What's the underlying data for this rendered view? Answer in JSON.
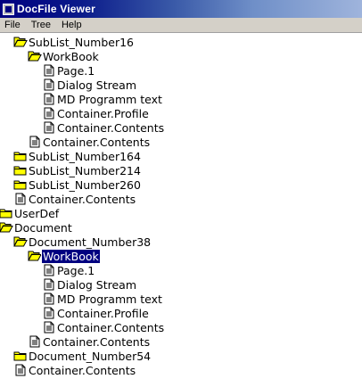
{
  "window": {
    "title": "DocFile Viewer"
  },
  "menu": {
    "file": "File",
    "tree": "Tree",
    "help": "Help"
  },
  "tree": {
    "nodes": [
      {
        "label": "SubList_Number16",
        "icon": "folder-open-icon",
        "depth": 2
      },
      {
        "label": "WorkBook",
        "icon": "folder-open-icon",
        "depth": 3
      },
      {
        "label": "Page.1",
        "icon": "document-icon",
        "depth": 4
      },
      {
        "label": "Dialog Stream",
        "icon": "document-icon",
        "depth": 4
      },
      {
        "label": "MD Programm text",
        "icon": "document-icon",
        "depth": 4
      },
      {
        "label": "Container.Profile",
        "icon": "document-icon",
        "depth": 4
      },
      {
        "label": "Container.Contents",
        "icon": "document-icon",
        "depth": 4
      },
      {
        "label": "Container.Contents",
        "icon": "document-icon",
        "depth": 3
      },
      {
        "label": "SubList_Number164",
        "icon": "folder-closed-icon",
        "depth": 2
      },
      {
        "label": "SubList_Number214",
        "icon": "folder-closed-icon",
        "depth": 2
      },
      {
        "label": "SubList_Number260",
        "icon": "folder-closed-icon",
        "depth": 2
      },
      {
        "label": "Container.Contents",
        "icon": "document-icon",
        "depth": 2
      },
      {
        "label": "UserDef",
        "icon": "folder-closed-icon",
        "depth": 1
      },
      {
        "label": "Document",
        "icon": "folder-open-icon",
        "depth": 1
      },
      {
        "label": "Document_Number38",
        "icon": "folder-open-icon",
        "depth": 2
      },
      {
        "label": "WorkBook",
        "icon": "folder-open-icon",
        "depth": 3,
        "selected": true
      },
      {
        "label": "Page.1",
        "icon": "document-icon",
        "depth": 4
      },
      {
        "label": "Dialog Stream",
        "icon": "document-icon",
        "depth": 4
      },
      {
        "label": "MD Programm text",
        "icon": "document-icon",
        "depth": 4
      },
      {
        "label": "Container.Profile",
        "icon": "document-icon",
        "depth": 4
      },
      {
        "label": "Container.Contents",
        "icon": "document-icon",
        "depth": 4
      },
      {
        "label": "Container.Contents",
        "icon": "document-icon",
        "depth": 3
      },
      {
        "label": "Document_Number54",
        "icon": "folder-closed-icon",
        "depth": 2
      },
      {
        "label": "Container.Contents",
        "icon": "document-icon",
        "depth": 2
      }
    ]
  },
  "colors": {
    "selection": "#000080",
    "folder": "#ffff00",
    "menubar": "#d4d0c8"
  }
}
